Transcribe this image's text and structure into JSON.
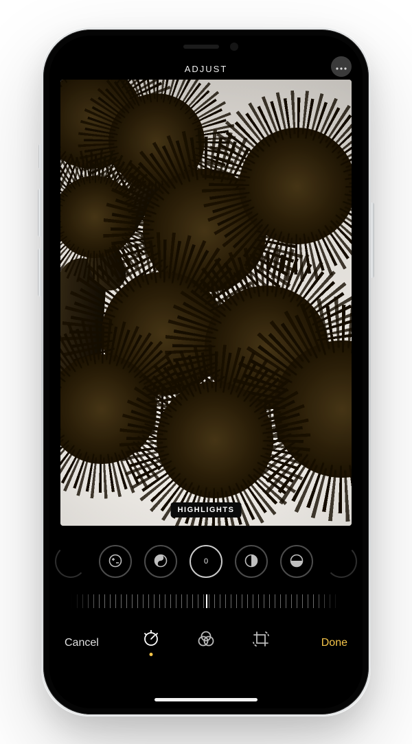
{
  "header": {
    "title": "ADJUST",
    "more_icon": "ellipsis"
  },
  "photo": {
    "param_label": "HIGHLIGHTS"
  },
  "dials": {
    "items": [
      {
        "id": "exposure",
        "icon": "plus-minus"
      },
      {
        "id": "brilliance",
        "icon": "yin-yang"
      },
      {
        "id": "highlights",
        "icon": "value",
        "label": "0",
        "active": true
      },
      {
        "id": "shadows",
        "icon": "half-circle-v"
      },
      {
        "id": "contrast",
        "icon": "half-circle-h"
      }
    ],
    "current_value": 0
  },
  "tabs": {
    "cancel_label": "Cancel",
    "done_label": "Done",
    "items": [
      {
        "id": "adjust",
        "icon": "sparkle-dial",
        "active": true
      },
      {
        "id": "filters",
        "icon": "three-circles"
      },
      {
        "id": "crop",
        "icon": "crop-rotate"
      }
    ]
  },
  "colors": {
    "accent": "#f5c449"
  }
}
